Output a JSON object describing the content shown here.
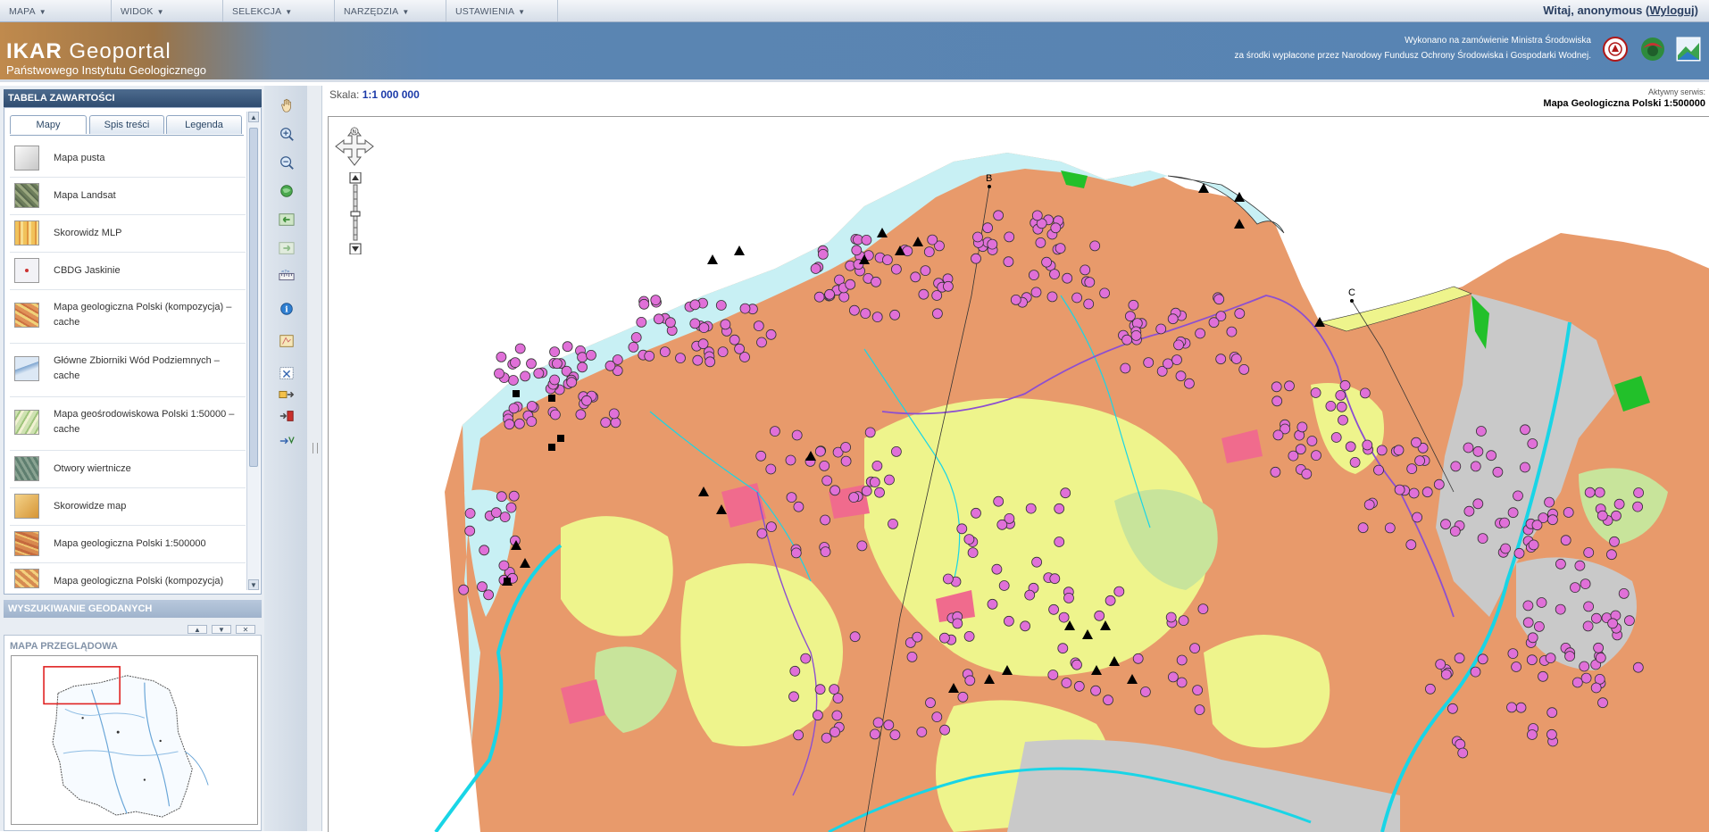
{
  "menubar": {
    "items": [
      "MAPA",
      "WIDOK",
      "SELEKCJA",
      "NARZĘDZIA",
      "USTAWIENIA"
    ],
    "welcome_prefix": "Witaj, anonymous (",
    "logout_label": "Wyloguj",
    "welcome_suffix": ")"
  },
  "header": {
    "title_bold": "IKAR",
    "title_rest": " Geoportal",
    "subtitle": "Państwowego Instytutu Geologicznego",
    "funding_line1": "Wykonano na zamówienie Ministra Środowiska",
    "funding_line2": "za środki wypłacone przez Narodowy Fundusz Ochrony Środowiska i Gospodarki Wodnej."
  },
  "toc": {
    "title": "TABELA ZAWARTOŚCI",
    "tabs": [
      "Mapy",
      "Spis treści",
      "Legenda"
    ],
    "layers": [
      {
        "label": "Mapa pusta",
        "icon": "blank-map-icon",
        "color": "#d9d9d9"
      },
      {
        "label": "Mapa Landsat",
        "icon": "landsat-map-icon",
        "color": "#7f8f6a"
      },
      {
        "label": "Skorowidz MLP",
        "icon": "mlp-index-icon",
        "color": "#e3b24b"
      },
      {
        "label": "CBDG Jaskinie",
        "icon": "caves-icon",
        "color": "#e8e8f0"
      },
      {
        "label": "Mapa geologiczna Polski (kompozycja) – cache",
        "icon": "geologic-map-icon",
        "color": "#d88b4f"
      },
      {
        "label": "Główne Zbiorniki Wód Podziemnych – cache",
        "icon": "groundwater-icon",
        "color": "#b9cfe6"
      },
      {
        "label": "Mapa geośrodowiskowa Polski 1:50000 – cache",
        "icon": "geoenvironmental-map-icon",
        "color": "#b7d39a"
      },
      {
        "label": "Otwory wiertnicze",
        "icon": "boreholes-icon",
        "color": "#6f8c7c"
      },
      {
        "label": "Skorowidze map",
        "icon": "map-index-icon",
        "color": "#e0b25a"
      },
      {
        "label": "Mapa geologiczna Polski 1:500000",
        "icon": "geologic-map-500k-icon",
        "color": "#d1884c"
      },
      {
        "label": "Mapa geologiczna Polski (kompozycja)",
        "icon": "geologic-composition-icon",
        "color": "#cf8a52"
      }
    ]
  },
  "search_panel": {
    "title": "WYSZUKIWANIE GEODANYCH"
  },
  "overview": {
    "title": "MAPA PRZEGLĄDOWA"
  },
  "map": {
    "scale_label": "Skala: ",
    "scale_value": "1:1 000 000",
    "service_caption": "Aktywny serwis:",
    "service_name": "Mapa Geologiczna Polski 1:500000",
    "annotations": [
      "B",
      "C"
    ],
    "colors": {
      "land_orange": "#e89a6b",
      "land_yellow": "#eef48c",
      "land_green": "#c8e49b",
      "water": "#c8f0f4",
      "gray": "#c9c9c9",
      "magenta_points": "#e070d8",
      "river": "#19d5e6",
      "boundary_purple": "#8c4fd1"
    }
  },
  "tools": [
    "pan-hand-icon",
    "zoom-in-icon",
    "zoom-out-icon",
    "full-extent-icon",
    "previous-extent-icon",
    "next-extent-icon",
    "measure-icon",
    "info-icon",
    "print-icon",
    "select-features-icon",
    "select-by-area-icon",
    "clear-selection-icon",
    "export-selection-icon"
  ]
}
